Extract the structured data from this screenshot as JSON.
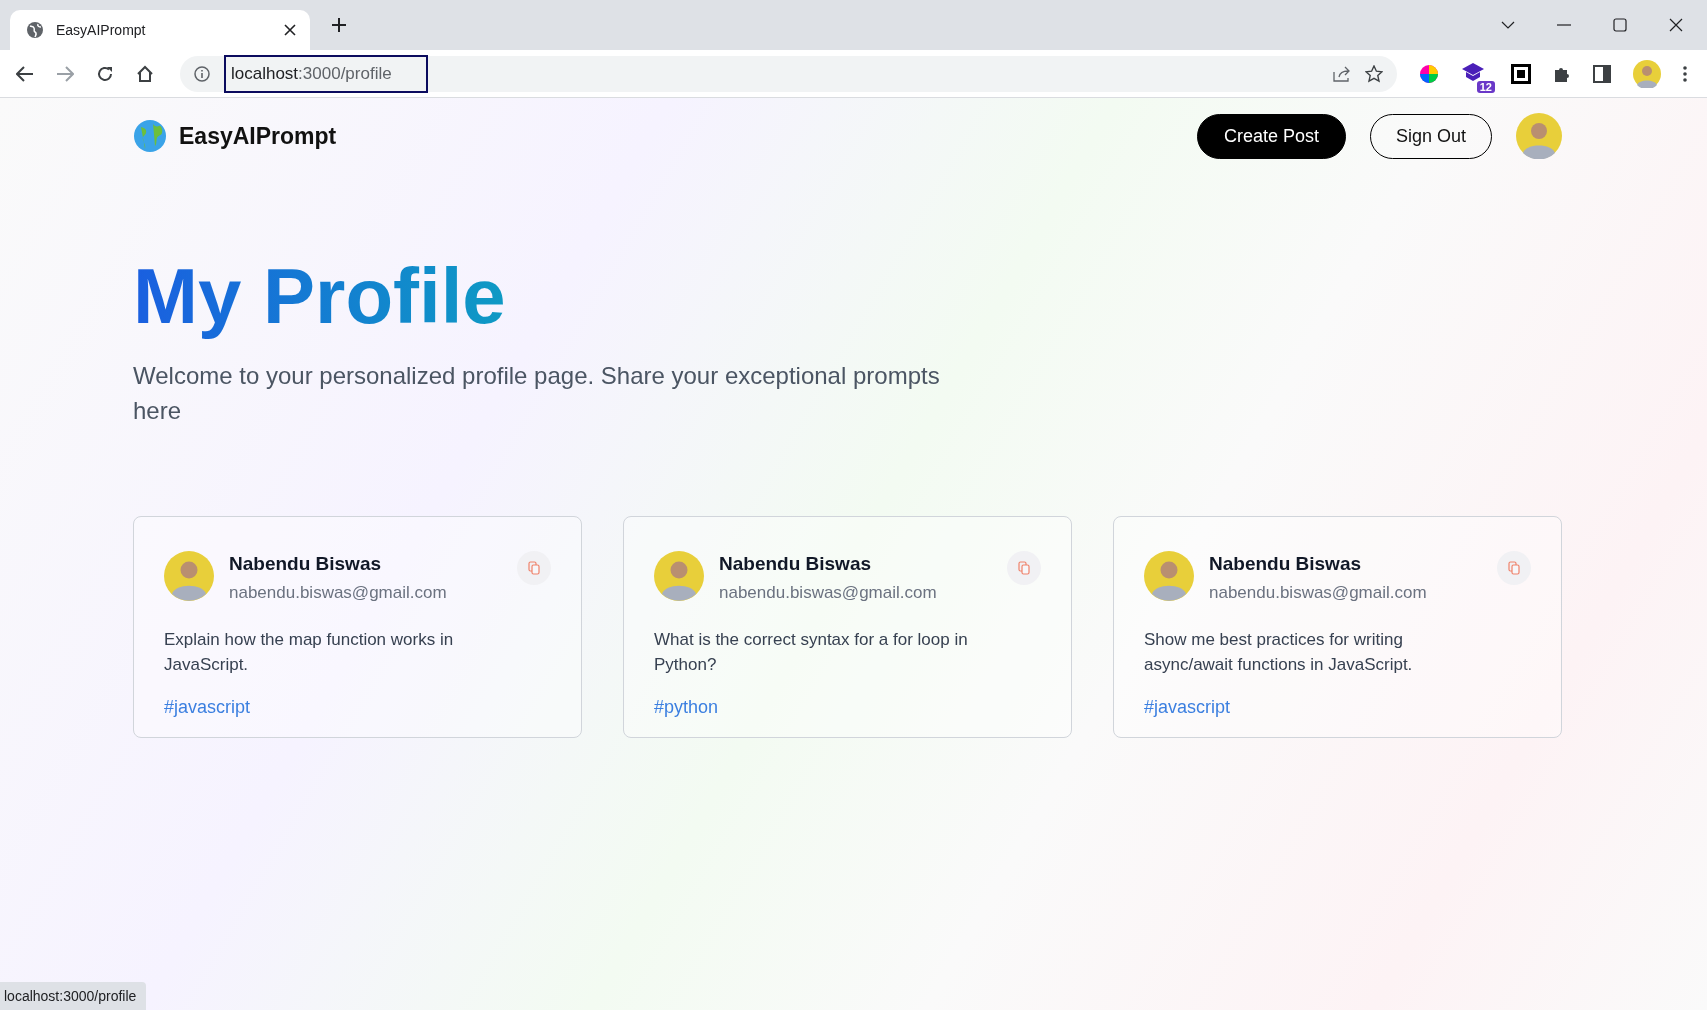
{
  "browser": {
    "tab_title": "EasyAIPrompt",
    "url_host": "localhost",
    "url_path": ":3000/profile",
    "extension_badge": "12"
  },
  "navbar": {
    "brand": "EasyAIPrompt",
    "create_button": "Create Post",
    "signout_button": "Sign Out"
  },
  "header": {
    "title": "My Profile",
    "description": "Welcome to your personalized profile page. Share your exceptional prompts here"
  },
  "prompts": [
    {
      "author": "Nabendu Biswas",
      "email": "nabendu.biswas@gmail.com",
      "text": "Explain how the map function works in JavaScript.",
      "tag": "#javascript"
    },
    {
      "author": "Nabendu Biswas",
      "email": "nabendu.biswas@gmail.com",
      "text": "What is the correct syntax for a for loop in Python?",
      "tag": "#python"
    },
    {
      "author": "Nabendu Biswas",
      "email": "nabendu.biswas@gmail.com",
      "text": "Show me best practices for writing async/await functions in JavaScript.",
      "tag": "#javascript"
    }
  ],
  "status_bar": "localhost:3000/profile"
}
